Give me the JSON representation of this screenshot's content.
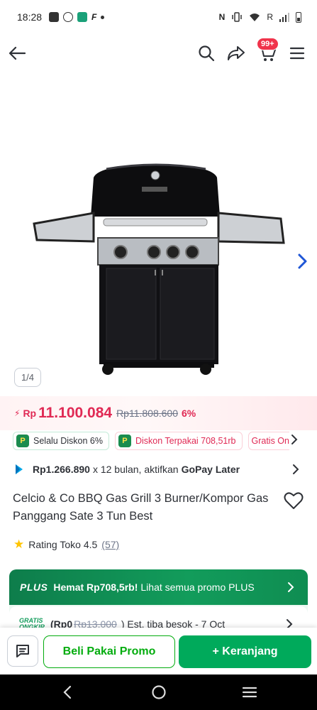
{
  "status_bar": {
    "time": "18:28",
    "carrier_letter": "R"
  },
  "header": {
    "cart_badge": "99+",
    "icons": [
      "back-arrow-icon",
      "search-icon",
      "share-icon",
      "cart-icon",
      "hamburger-menu-icon"
    ]
  },
  "gallery": {
    "counter": "1/4"
  },
  "price": {
    "currency": "Rp",
    "current": "11.100.084",
    "original": "Rp11.808.600",
    "discount": "6%"
  },
  "promos": [
    {
      "label": "Selalu Diskon 6%"
    },
    {
      "label": "Diskon Terpakai 708,51rb"
    },
    {
      "label": "Gratis Ong"
    }
  ],
  "installment": {
    "amount": "Rp1.266.890",
    "text": "x 12 bulan, aktifkan",
    "provider": "GoPay Later"
  },
  "product": {
    "title": "Celcio & Co BBQ Gas Grill 3 Burner/Kompor Gas Panggang Sate 3 Tun Best"
  },
  "rating": {
    "label": "Rating Toko 4.5",
    "count": "(57)"
  },
  "plus": {
    "logo": "PLUS",
    "highlight": "Hemat Rp708,5rb!",
    "text": "Lihat semua promo PLUS"
  },
  "shipping": {
    "logo_line1": "GRATIS",
    "logo_line2": "ONGKIR",
    "price": "(Rp0",
    "original": "Rp13.000",
    "eta": ") Est. tiba besok - 7 Oct"
  },
  "actions": {
    "buy_promo": "Beli Pakai Promo",
    "add_cart": "+ Keranjang"
  },
  "colors": {
    "primary_green": "#00aa5b",
    "price_red": "#e02954"
  }
}
